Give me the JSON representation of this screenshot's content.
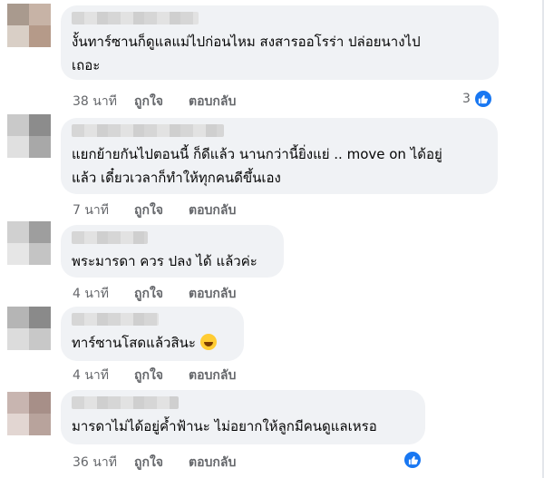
{
  "colors": {
    "bubble": "#f0f2f5",
    "meta_text": "#65676b",
    "like_blue": "#1877f2"
  },
  "comments": [
    {
      "text": "งั้นทาร์ซานก็ดูแลแม่ไปก่อนไหม สงสารออโรร่า ปล่อยนางไป\nเถอะ",
      "time": "38 นาที",
      "like": "ถูกใจ",
      "reply": "ตอบกลับ",
      "reaction_count": "3",
      "reaction_icon": "like-icon"
    },
    {
      "text": "แยกย้ายกันไปตอนนี้ ก็ดีแล้ว นานกว่านี้ยิ่งแย่ .. move on ได้อยู่\nแล้ว เดี๋ยวเวลาก็ทำให้ทุกคนดีขึ้นเอง",
      "time": "7 นาที",
      "like": "ถูกใจ",
      "reply": "ตอบกลับ"
    },
    {
      "text": "พระมารดา ควร ปลง ได้ แล้วค่ะ",
      "time": "4 นาที",
      "like": "ถูกใจ",
      "reply": "ตอบกลับ"
    },
    {
      "text": "ทาร์ซานโสดแล้วสินะ",
      "emoji": "laughing-emoji",
      "time": "4 นาที",
      "like": "ถูกใจ",
      "reply": "ตอบกลับ"
    },
    {
      "text": "มารดาไม่ได้อยู่ค้ำฟ้านะ ไม่อยากให้ลูกมีคนดูแลเหรอ",
      "time": "36 นาที",
      "like": "ถูกใจ",
      "reply": "ตอบกลับ",
      "reaction_icon": "like-icon"
    }
  ]
}
